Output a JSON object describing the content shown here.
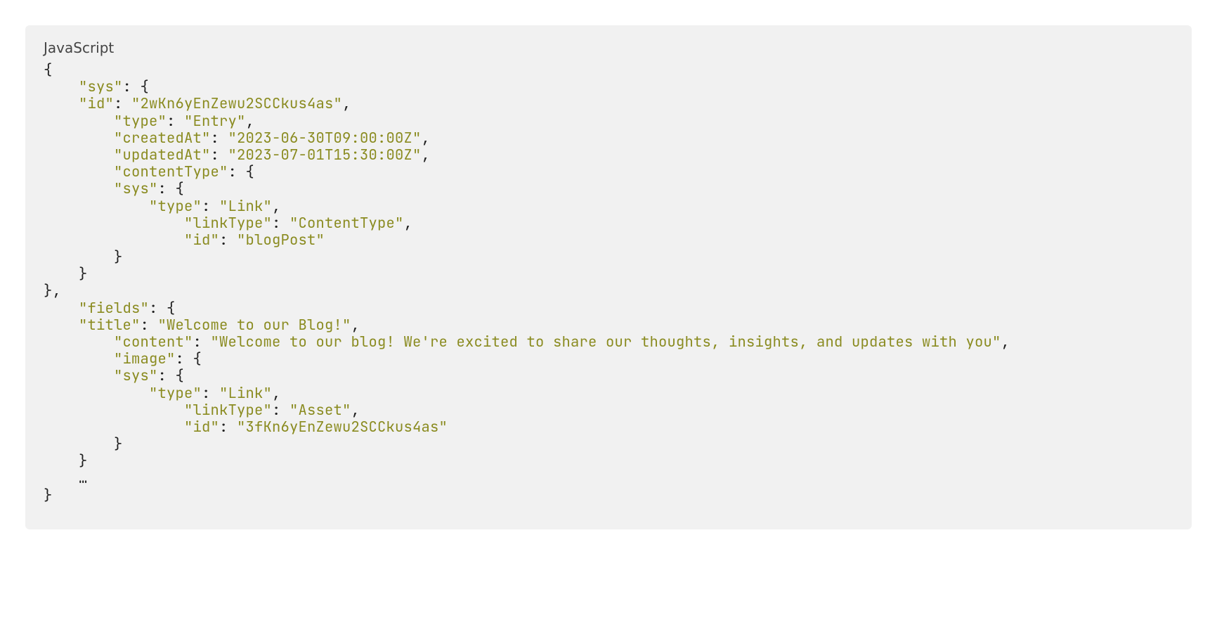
{
  "label": "JavaScript",
  "code": {
    "sys": {
      "id": "2wKn6yEnZewu2SCCkus4as",
      "type": "Entry",
      "createdAt": "2023-06-30T09:00:00Z",
      "updatedAt": "2023-07-01T15:30:00Z",
      "contentType": {
        "sys": {
          "type": "Link",
          "linkType": "ContentType",
          "id": "blogPost"
        }
      }
    },
    "fields": {
      "title": "Welcome to our Blog!",
      "content": "Welcome to our blog! We're excited to share our thoughts, insights, and updates with you",
      "image": {
        "sys": {
          "type": "Link",
          "linkType": "Asset",
          "id": "3fKn6yEnZewu2SCCkus4as"
        }
      }
    },
    "ellipsis": "…"
  }
}
